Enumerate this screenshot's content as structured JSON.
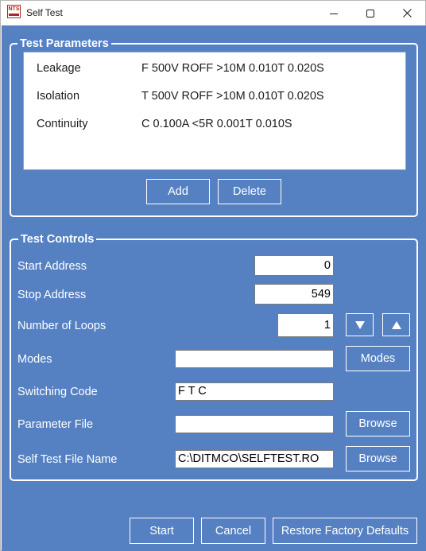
{
  "window": {
    "title": "Self Test",
    "app_icon_text": "NTS"
  },
  "test_parameters": {
    "group_title": "Test Parameters",
    "items": [
      {
        "name": "Leakage",
        "value": "F 500V ROFF >10M 0.010T 0.020S"
      },
      {
        "name": "Isolation",
        "value": "T 500V ROFF >10M 0.010T 0.020S"
      },
      {
        "name": "Continuity",
        "value": "C 0.100A  <5R 0.001T 0.010S"
      }
    ],
    "add_label": "Add",
    "delete_label": "Delete"
  },
  "test_controls": {
    "group_title": "Test Controls",
    "start_address": {
      "label": "Start Address",
      "value": "0"
    },
    "stop_address": {
      "label": "Stop Address",
      "value": "549"
    },
    "number_of_loops": {
      "label": "Number of Loops",
      "value": "1"
    },
    "modes": {
      "label": "Modes",
      "value": "",
      "button_label": "Modes"
    },
    "switching_code": {
      "label": "Switching Code",
      "value": "F T C"
    },
    "parameter_file": {
      "label": "Parameter File",
      "value": "",
      "button_label": "Browse"
    },
    "self_test_file": {
      "label": "Self Test File Name",
      "value": "C:\\DITMCO\\SELFTEST.RO",
      "button_label": "Browse"
    }
  },
  "footer": {
    "start_label": "Start",
    "cancel_label": "Cancel",
    "restore_label": "Restore Factory Defaults"
  },
  "colors": {
    "panel_background": "#5581c3",
    "accent_border": "#ffffff"
  }
}
